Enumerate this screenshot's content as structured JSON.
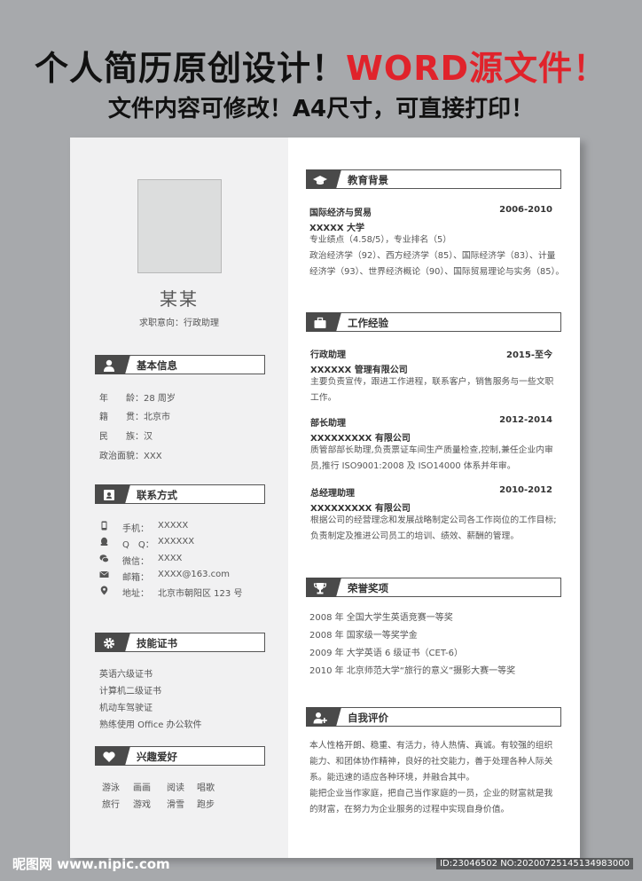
{
  "banner": {
    "line1_a": "个人简历原创设计！",
    "line1_b": "WORD源文件！",
    "line2": "文件内容可修改！A4尺寸，可直接打印！"
  },
  "colors": {
    "accent_red": "#e0232b",
    "dark_tab": "#4a4a4a",
    "sidebar_bg": "#f1f1f2"
  },
  "profile": {
    "name": "某某",
    "intent": "求职意向：行政助理"
  },
  "basic": {
    "title": "基本信息",
    "icon": "person-icon",
    "rows": [
      {
        "label": "年　　龄：",
        "value": "28 周岁"
      },
      {
        "label": "籍　　贯：",
        "value": "北京市"
      },
      {
        "label": "民　　族：",
        "value": "汉"
      },
      {
        "label": "政治面貌：",
        "value": "XXX"
      }
    ]
  },
  "contact": {
    "title": "联系方式",
    "icon": "contact-card-icon",
    "rows": [
      {
        "icon": "phone-icon",
        "label": "手机：",
        "value": "XXXXX"
      },
      {
        "icon": "qq-icon",
        "label": "Q　Q：",
        "value": "XXXXXX"
      },
      {
        "icon": "wechat-icon",
        "label": "微信：",
        "value": "XXXX"
      },
      {
        "icon": "mail-icon",
        "label": "邮箱：",
        "value": "XXXX@163.com"
      },
      {
        "icon": "location-icon",
        "label": "地址：",
        "value": "北京市朝阳区 123 号"
      }
    ]
  },
  "skills": {
    "title": "技能证书",
    "icon": "gear-icon",
    "items": [
      "英语六级证书",
      "计算机二级证书",
      "机动车驾驶证",
      "熟练使用 Office 办公软件"
    ]
  },
  "hobbies": {
    "title": "兴趣爱好",
    "icon": "heart-icon",
    "items": [
      "游泳",
      "画画",
      "阅读",
      "唱歌",
      "旅行",
      "游戏",
      "滑雪",
      "跑步"
    ]
  },
  "education": {
    "title": "教育背景",
    "icon": "graduation-cap-icon",
    "major": "国际经济与贸易",
    "period": "2006-2010",
    "school": "XXXXX 大学",
    "lines": [
      "专业绩点（4.58/5），专业排名（5）",
      "政治经济学（92）、西方经济学（85）、国际经济学（83）、计量",
      "经济学（93）、世界经济概论（90）、国际贸易理论与实务（85）。"
    ]
  },
  "work": {
    "title": "工作经验",
    "icon": "briefcase-icon",
    "jobs": [
      {
        "role": "行政助理",
        "period": "2015-至今",
        "company": "XXXXXX 管理有限公司",
        "lines": [
          "主要负责宣传，跟进工作进程，联系客户，销售服务与一些文职",
          "工作。"
        ]
      },
      {
        "role": "部长助理",
        "period": "2012-2014",
        "company": "XXXXXXXXX 有限公司",
        "lines": [
          "质管部部长助理,负责票证车间生产质量检查,控制,兼任企业内审",
          "员,推行 ISO9001:2008 及 ISO14000 体系并年审。"
        ]
      },
      {
        "role": "总经理助理",
        "period": "2010-2012",
        "company": "XXXXXXXXX 有限公司",
        "lines": [
          "根据公司的经营理念和发展战略制定公司各工作岗位的工作目标;",
          "负责制定及推进公司员工的培训、绩效、薪酬的管理。"
        ]
      }
    ]
  },
  "awards": {
    "title": "荣誉奖项",
    "icon": "trophy-icon",
    "items": [
      "2008  年  全国大学生英语竞赛一等奖",
      "2008  年  国家级一等奖学金",
      "2009  年  大学英语 6 级证书（CET-6）",
      "2010  年  北京师范大学“旅行的意义”摄影大赛一等奖"
    ]
  },
  "self": {
    "title": "自我评价",
    "icon": "person-plus-icon",
    "lines": [
      "本人性格开朗、稳重、有活力，待人热情、真诚。有较强的组织",
      "能力、和团体协作精神，良好的社交能力，善于处理各种人际关",
      "系。能迅速的适应各种环境，并融合其中。",
      "能把企业当作家庭，把自己当作家庭的一员，企业的财富就是我",
      "的财富，在努力为企业服务的过程中实现自身价值。"
    ]
  },
  "footer": {
    "watermark": "昵图网 www.nipic.com",
    "id": "ID:23046502 NO:20200725145134983000"
  }
}
